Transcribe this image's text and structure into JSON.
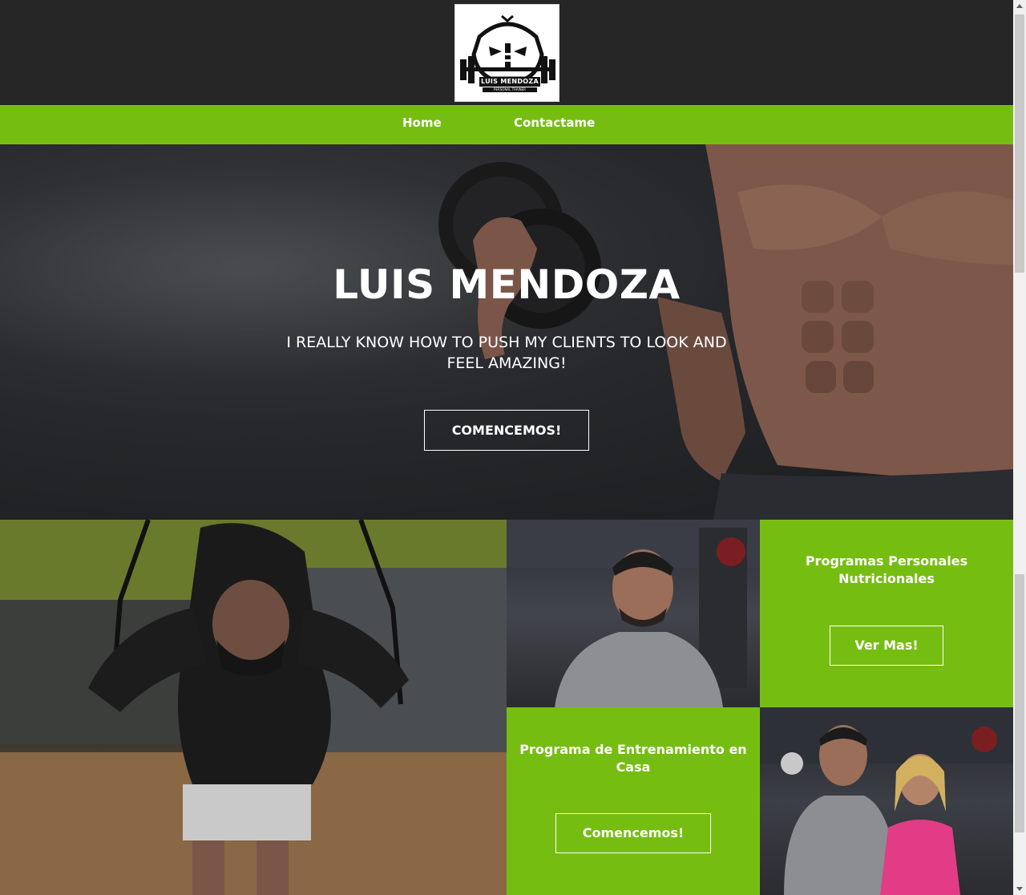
{
  "header": {
    "logo_icon": "skull-barbell-logo",
    "logo_text": "LUIS MENDOZA",
    "logo_subtext": "PERSONAL TRAINER"
  },
  "nav": {
    "items": [
      {
        "label": "Home"
      },
      {
        "label": "Contactame"
      }
    ]
  },
  "hero": {
    "title": "LUIS MENDOZA",
    "subtitle": "I REALLY KNOW HOW TO PUSH MY CLIENTS TO LOOK AND FEEL AMAZING!",
    "button_label": "COMENCEMOS!"
  },
  "cards": {
    "nutrition": {
      "title": "Programas Personales Nutricionales",
      "button_label": "Ver Mas!"
    },
    "home_training": {
      "title": "Programa de Entrenamiento en Casa",
      "button_label": "Comencemos!"
    }
  },
  "colors": {
    "accent": "#76bd12",
    "header_bg": "#262626",
    "text": "#ffffff"
  }
}
